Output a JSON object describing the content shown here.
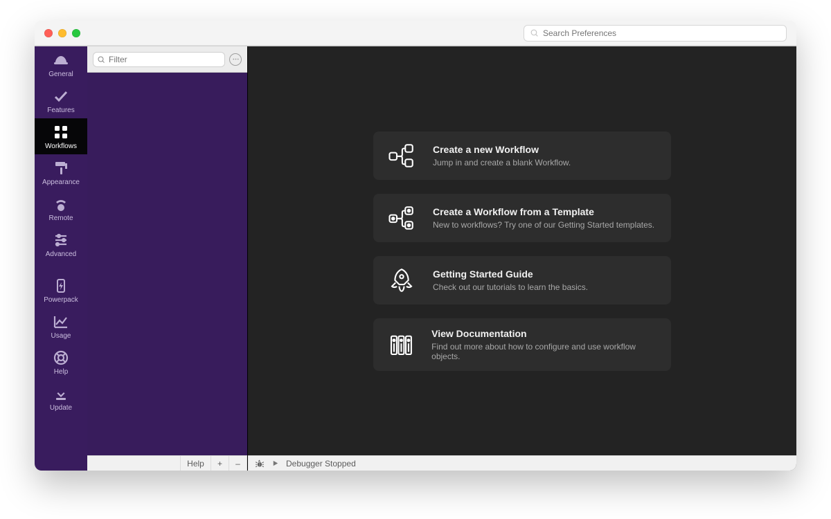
{
  "titlebar": {
    "search_placeholder": "Search Preferences"
  },
  "sidebar": {
    "items": [
      {
        "id": "general",
        "label": "General"
      },
      {
        "id": "features",
        "label": "Features"
      },
      {
        "id": "workflows",
        "label": "Workflows"
      },
      {
        "id": "appearance",
        "label": "Appearance"
      },
      {
        "id": "remote",
        "label": "Remote"
      },
      {
        "id": "advanced",
        "label": "Advanced"
      },
      {
        "id": "powerpack",
        "label": "Powerpack"
      },
      {
        "id": "usage",
        "label": "Usage"
      },
      {
        "id": "help",
        "label": "Help"
      },
      {
        "id": "update",
        "label": "Update"
      }
    ],
    "selected_id": "workflows"
  },
  "filter": {
    "placeholder": "Filter"
  },
  "list_footer": {
    "help_label": "Help",
    "plus_label": "+",
    "minus_label": "–"
  },
  "cards": [
    {
      "id": "new",
      "title": "Create a new Workflow",
      "subtitle": "Jump in and create a blank Workflow."
    },
    {
      "id": "template",
      "title": "Create a Workflow from a Template",
      "subtitle": "New to workflows? Try one of our Getting Started templates."
    },
    {
      "id": "guide",
      "title": "Getting Started Guide",
      "subtitle": "Check out our tutorials to learn the basics."
    },
    {
      "id": "docs",
      "title": "View Documentation",
      "subtitle": "Find out more about how to configure and use workflow objects."
    }
  ],
  "debugger": {
    "status": "Debugger Stopped"
  }
}
